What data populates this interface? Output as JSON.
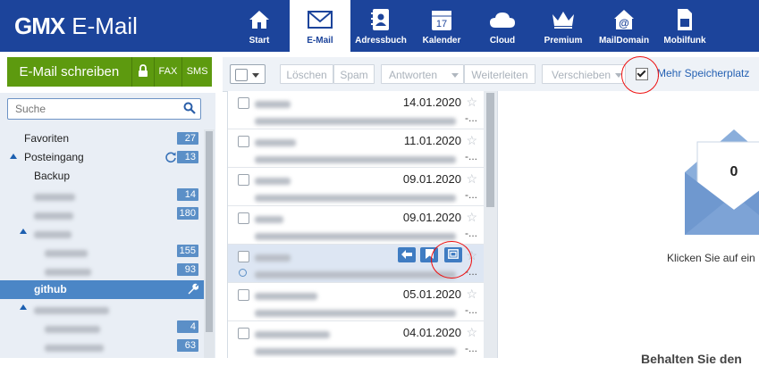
{
  "brand": {
    "logo_bold": "GMX",
    "logo_text": "E-Mail"
  },
  "nav": [
    {
      "label": "Start",
      "icon": "home-icon"
    },
    {
      "label": "E-Mail",
      "icon": "envelope-icon",
      "active": true
    },
    {
      "label": "Adressbuch",
      "icon": "address-book-icon"
    },
    {
      "label": "Kalender",
      "icon": "calendar-icon",
      "day": "17"
    },
    {
      "label": "Cloud",
      "icon": "cloud-icon"
    },
    {
      "label": "Premium",
      "icon": "crown-icon"
    },
    {
      "label": "MailDomain",
      "icon": "at-house-icon"
    },
    {
      "label": "Mobilfunk",
      "icon": "sim-card-icon"
    }
  ],
  "compose": {
    "label": "E-Mail schreiben",
    "fax": "FAX",
    "sms": "SMS",
    "lock_icon": "lock-icon"
  },
  "search": {
    "placeholder": "Suche",
    "icon": "search-icon"
  },
  "folders": [
    {
      "name": "Favoriten",
      "count": "27"
    },
    {
      "name": "Posteingang",
      "count": "13",
      "expanded": true,
      "refresh_icon": "refresh-icon"
    },
    {
      "name": "Backup",
      "count": ""
    },
    {
      "name": "",
      "count": "14"
    },
    {
      "name": "",
      "count": "180"
    },
    {
      "name": "",
      "count": "",
      "expanded": true
    },
    {
      "name": "",
      "count": "155"
    },
    {
      "name": "",
      "count": "93"
    },
    {
      "name": "github",
      "count": "",
      "active": true,
      "wrench_icon": "wrench-icon"
    },
    {
      "name": "",
      "count": "",
      "expanded": true
    },
    {
      "name": "",
      "count": "4"
    },
    {
      "name": "",
      "count": "63"
    }
  ],
  "toolbar": {
    "delete": "Löschen",
    "spam": "Spam",
    "reply": "Antworten",
    "forward": "Weiterleiten",
    "move": "Verschieben",
    "storage_link": "Mehr Speicherplatz"
  },
  "mails": [
    {
      "date": "14.01.2020",
      "more": "-..."
    },
    {
      "date": "11.01.2020",
      "more": "-..."
    },
    {
      "date": "09.01.2020",
      "more": "-..."
    },
    {
      "date": "09.01.2020",
      "more": "-..."
    },
    {
      "date": "",
      "more": "-...",
      "hover": true
    },
    {
      "date": "05.01.2020",
      "more": "-..."
    },
    {
      "date": "04.01.2020",
      "more": "-..."
    }
  ],
  "preview": {
    "count": "0",
    "hint": "Klicken Sie auf ein",
    "cut_text": "Behalten Sie den"
  },
  "colors": {
    "header": "#1c449b",
    "compose": "#5d9a0f",
    "accent": "#4b86c6",
    "annotation": "#e11111"
  }
}
